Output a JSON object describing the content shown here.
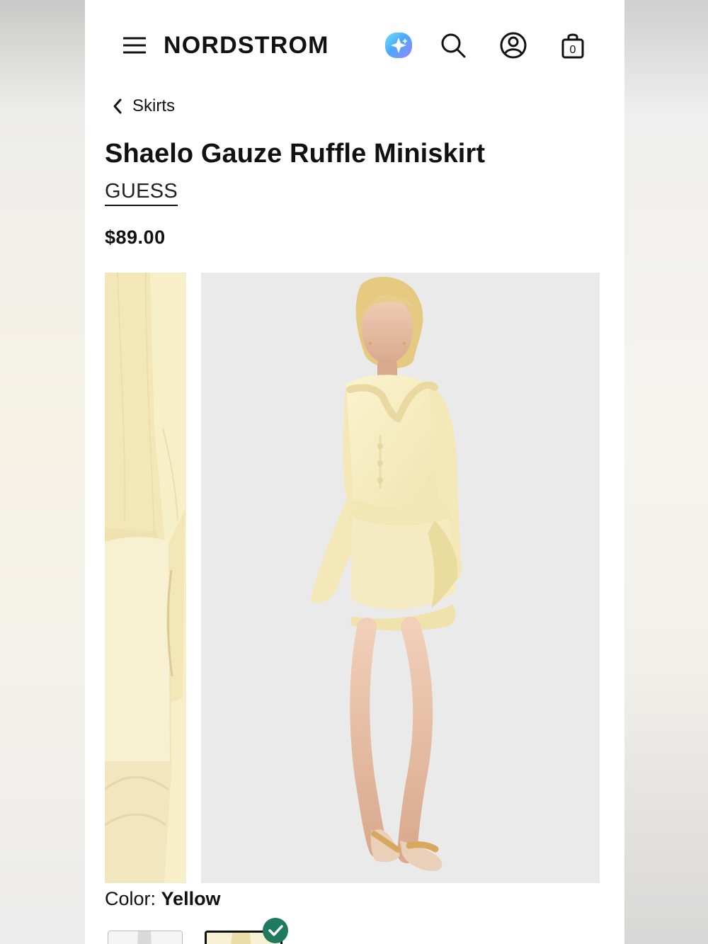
{
  "header": {
    "logo": "NORDSTROM",
    "icons": {
      "menu": "menu-icon",
      "assistant": "spark-icon",
      "search": "search-icon",
      "account": "account-icon",
      "bag": "bag-icon"
    },
    "bag_count": "0"
  },
  "breadcrumb": {
    "label": "Skirts"
  },
  "product": {
    "title": "Shaelo Gauze Ruffle Miniskirt",
    "brand": "GUESS",
    "price": "$89.00"
  },
  "color": {
    "label": "Color: ",
    "value": "Yellow"
  },
  "colors": {
    "accent": "#111111",
    "selected_check": "#1e7b5d",
    "product_yellow": "#f4ebc3"
  }
}
